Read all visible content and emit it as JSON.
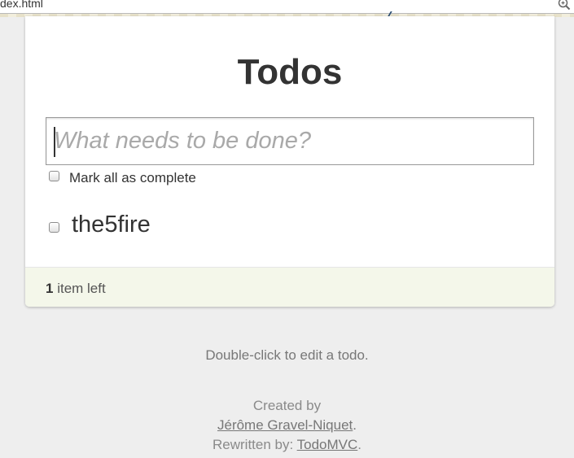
{
  "browser": {
    "url_fragment": "dex.html",
    "zoom_icon": "zoom-icon"
  },
  "app": {
    "title": "Todos",
    "new_todo_placeholder": "What needs to be done?",
    "mark_all_label": "Mark all as complete",
    "todos": [
      {
        "text": "the5fire",
        "completed": false
      }
    ],
    "footer": {
      "count": "1",
      "count_suffix": " item left"
    }
  },
  "info": {
    "hint": "Double-click to edit a todo.",
    "created_by": "Created by",
    "author": "Jérôme Gravel-Niquet",
    "author_suffix": ".",
    "rewritten_by": "Rewritten by: ",
    "rewritten_link": "TodoMVC",
    "rewritten_suffix": "."
  }
}
